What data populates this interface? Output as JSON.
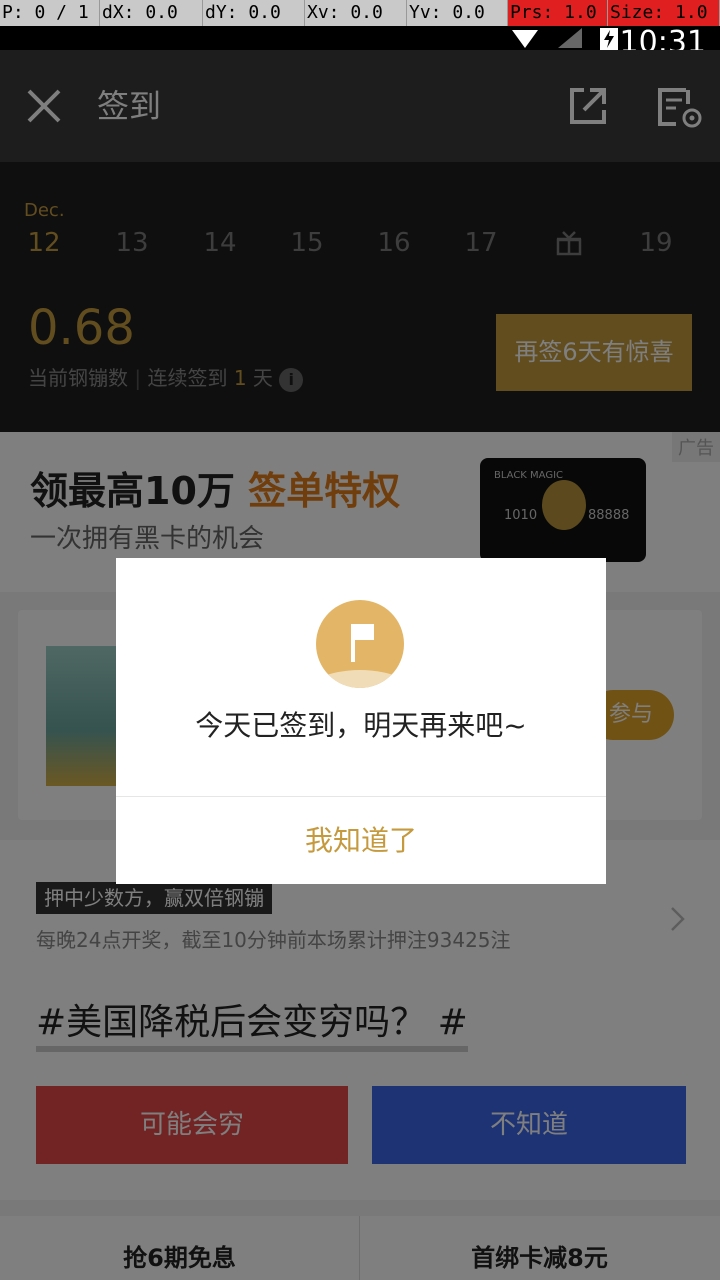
{
  "debug": {
    "p": "P: 0 / 1",
    "dx": "dX: 0.0",
    "dy": "dY: 0.0",
    "xv": "Xv: 0.0",
    "yv": "Yv: 0.0",
    "prs": "Prs: 1.0",
    "size": "Size: 1.0"
  },
  "status": {
    "time": "10:31"
  },
  "app_bar": {
    "title": "签到",
    "icons": [
      "close-icon",
      "share-icon",
      "rules-icon"
    ]
  },
  "calendar": {
    "month": "Dec.",
    "days": [
      "12",
      "13",
      "14",
      "15",
      "16",
      "17",
      "",
      "19"
    ],
    "active_index": 0,
    "gift_index": 6
  },
  "balance": {
    "value": "0.68",
    "label": "当前钢镚数",
    "streak_prefix": "连续签到",
    "streak_days": "1",
    "streak_suffix": "天"
  },
  "cta": {
    "label": "再签6天有惊喜"
  },
  "ad": {
    "tag": "广告",
    "title_main": "领最高10万",
    "title_highlight": "签单特权",
    "subtitle": "一次拥有黑卡的机会",
    "card_brand": "BLACK MAGIC",
    "card_num_a": "1010",
    "card_num_b": "88888"
  },
  "promo": {
    "button": "参与"
  },
  "lottery": {
    "tag": "押中少数方，赢双倍钢镚",
    "desc": "每晚24点开奖，截至10分钟前本场累计押注93425注",
    "question": "#美国降税后会变穷吗？ #",
    "option_a": "可能会穷",
    "option_b": "不知道"
  },
  "bottom": {
    "left": "抢6期免息",
    "right": "首绑卡减8元"
  },
  "dialog": {
    "message": "今天已签到，明天再来吧~",
    "button": "我知道了"
  },
  "colors": {
    "accent": "#c59a3e",
    "option_a": "#e54848",
    "option_b": "#3a66e6"
  }
}
